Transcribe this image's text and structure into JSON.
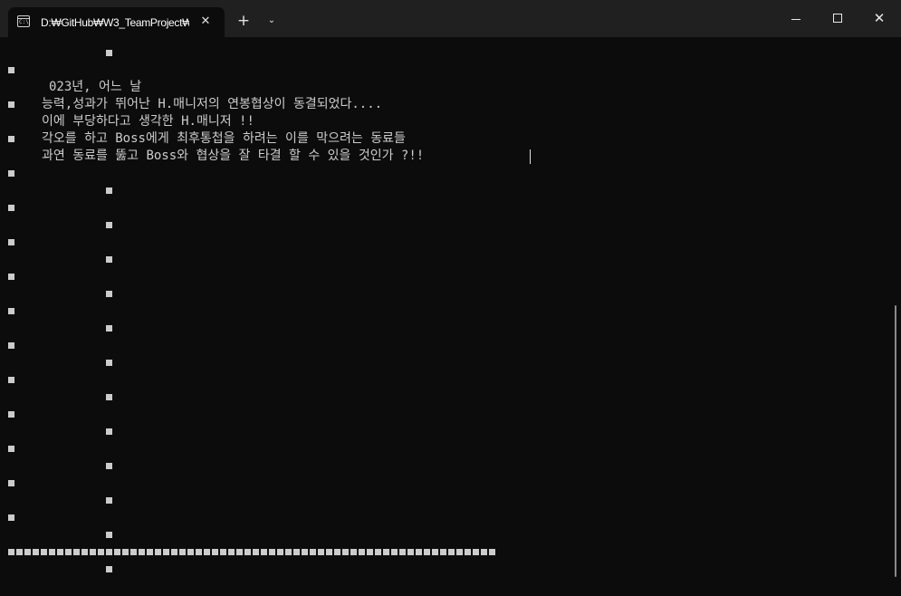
{
  "titlebar": {
    "tab_title": "D:₩GitHub₩W3_TeamProject₩",
    "tab_icon": "terminal-icon",
    "tab_icon_glyph": "C:\\",
    "close_tab": "✕",
    "new_tab": "+",
    "dropdown": "⌄",
    "window_controls": {
      "minimize": "minimize-icon",
      "maximize": "maximize-icon",
      "close": "✕"
    }
  },
  "console": {
    "lines": [
      "023년, 어느 날",
      "능력,성과가 뛰어난 H.매니저의 연봉협상이 동결되었다....",
      "이에 부당하다고 생각한 H.매니저 !!",
      "각오를 하고 Boss에게 최후통첩을 하려는 이를 막으려는 동료들",
      "과연 동료를 뚫고 Boss와 협상을 잘 타결 할 수 있을 것인가 ?!!"
    ],
    "block_glyph": "■",
    "block_count_bottom_row": 60
  },
  "colors": {
    "background": "#0c0c0c",
    "titlebar": "#202020",
    "text": "#cccccc",
    "scroll_thumb": "#8a8a8a"
  }
}
